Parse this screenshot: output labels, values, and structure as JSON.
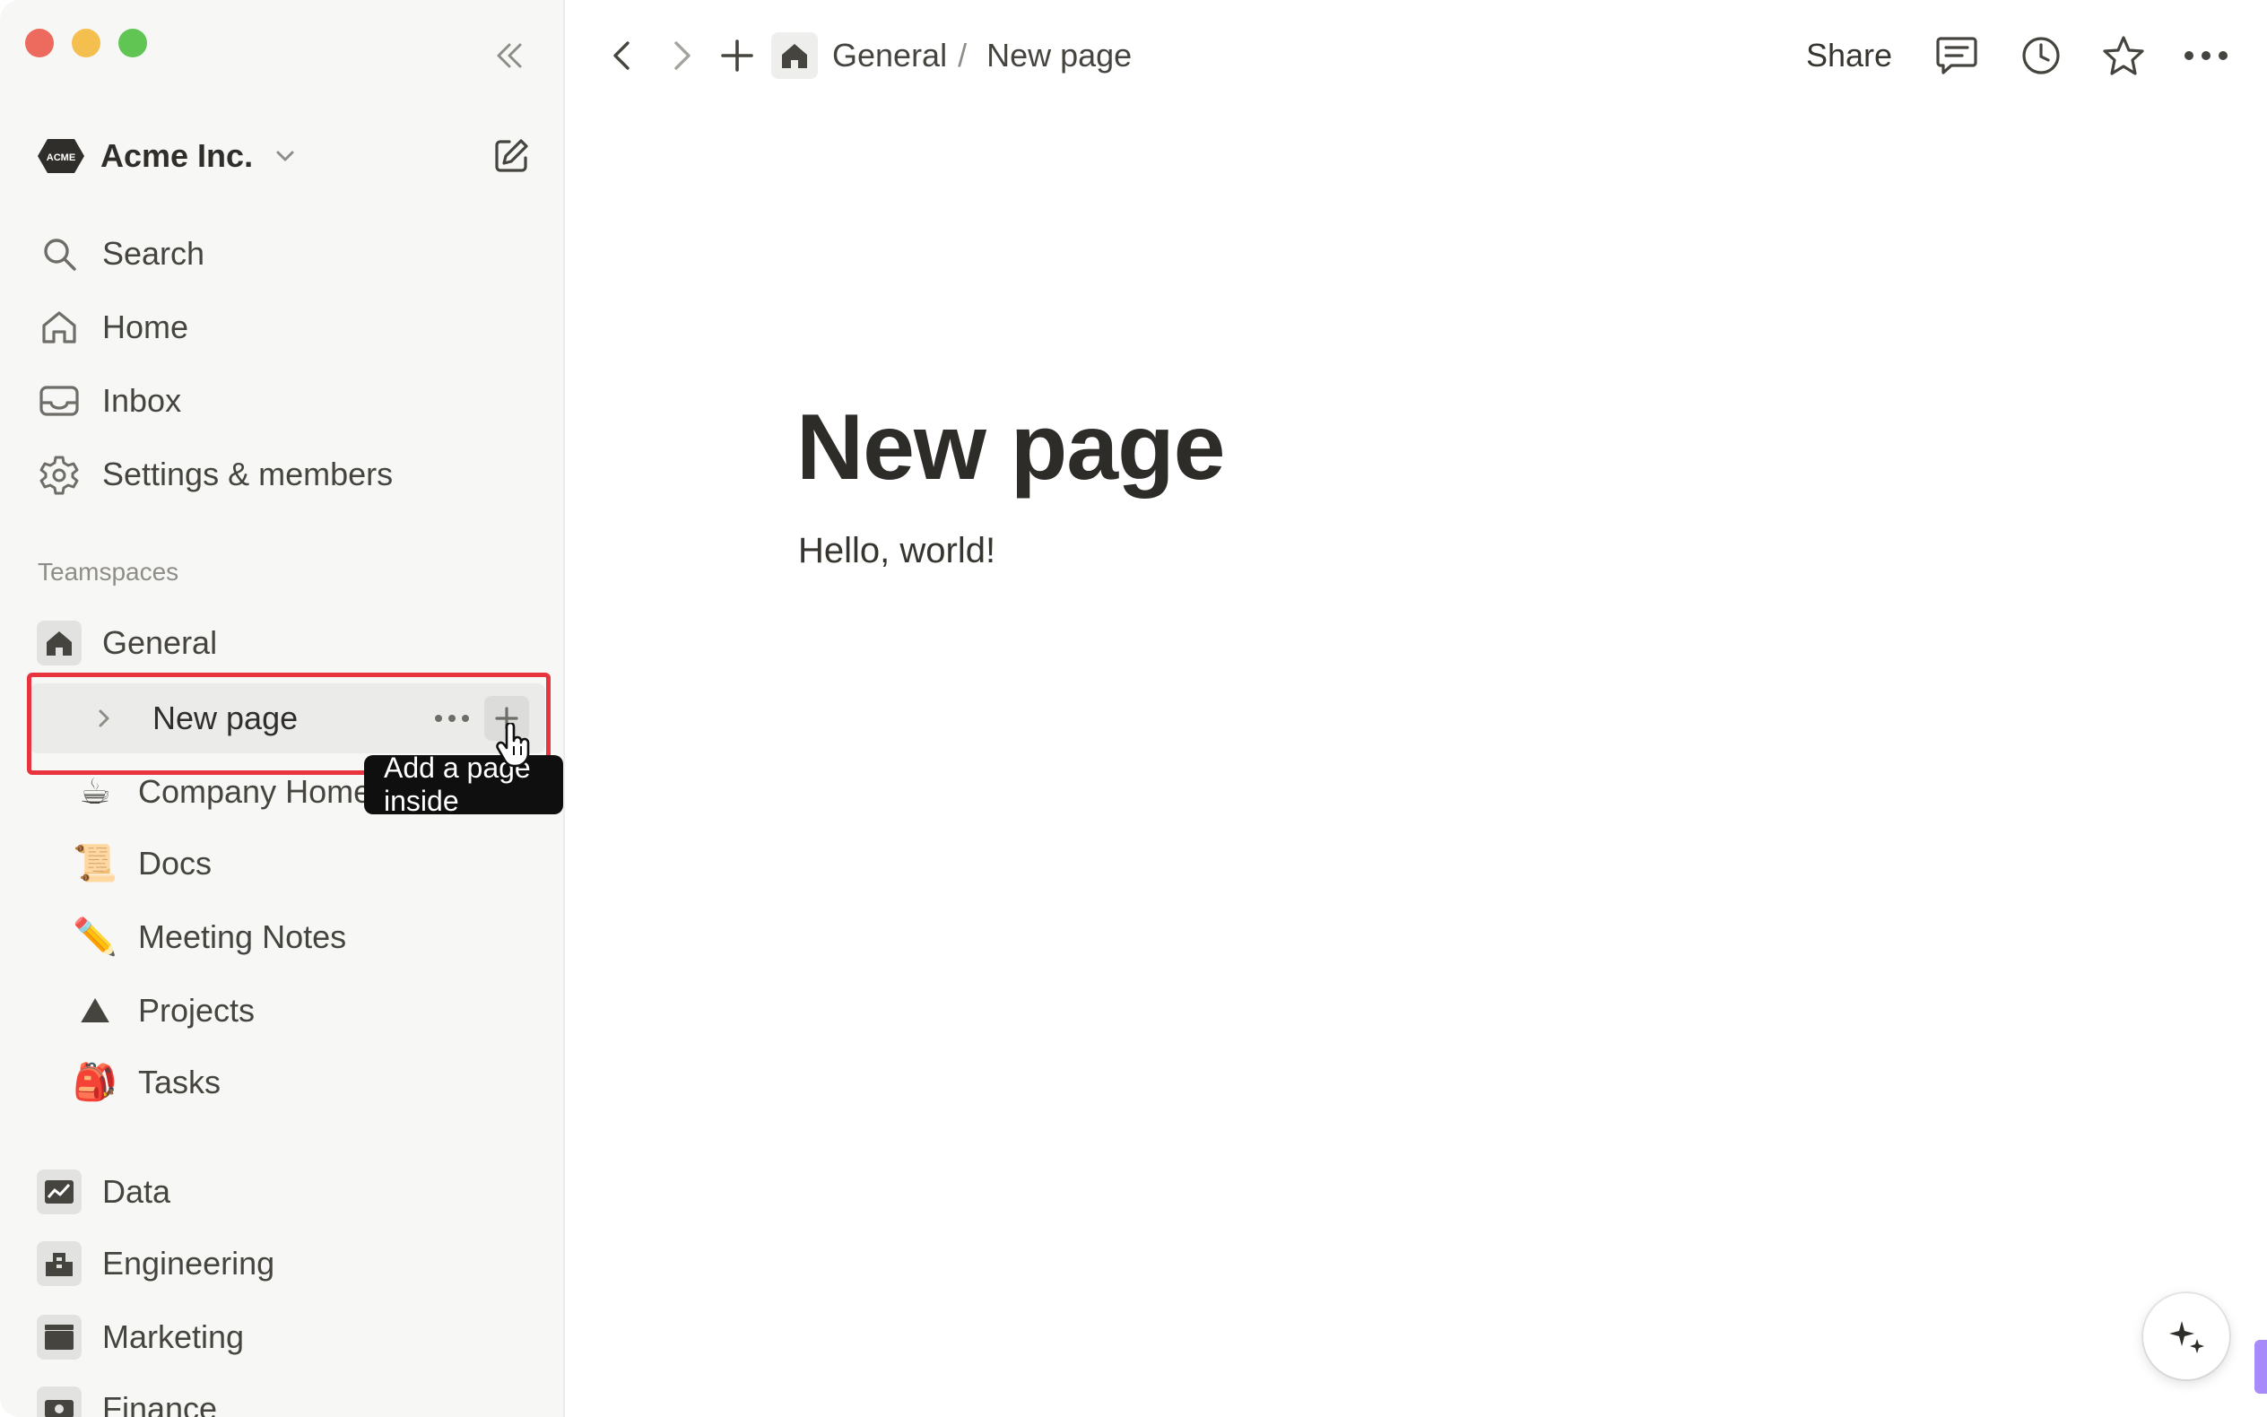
{
  "sidebar": {
    "workspace": {
      "name": "Acme Inc.",
      "logo_text": "ACME"
    },
    "nav": [
      {
        "label": "Search",
        "icon": "search-icon"
      },
      {
        "label": "Home",
        "icon": "home-icon"
      },
      {
        "label": "Inbox",
        "icon": "inbox-icon"
      },
      {
        "label": "Settings & members",
        "icon": "gear-icon"
      }
    ],
    "section_label": "Teamspaces",
    "teamspace_general": "General",
    "pages": {
      "new_page": "New page",
      "company_home": "Company Home",
      "docs": "Docs",
      "meeting_notes": "Meeting Notes",
      "projects": "Projects",
      "tasks": "Tasks"
    },
    "emojis": {
      "company_home": "☕",
      "docs": "📜",
      "meeting_notes": "✏️",
      "projects": "⛰",
      "tasks": "🎒"
    },
    "teamspaces": {
      "data": "Data",
      "engineering": "Engineering",
      "marketing": "Marketing",
      "finance": "Finance"
    },
    "tooltip": "Add a page inside"
  },
  "topbar": {
    "breadcrumb_general": "General",
    "breadcrumb_sep": "/",
    "breadcrumb_page": "New page",
    "share_label": "Share"
  },
  "page": {
    "title": "New page",
    "body": "Hello, world!"
  },
  "colors": {
    "highlight": "#e8343f",
    "sidebar_bg": "#f7f7f5",
    "tooltip_bg": "#0f0f0f"
  }
}
